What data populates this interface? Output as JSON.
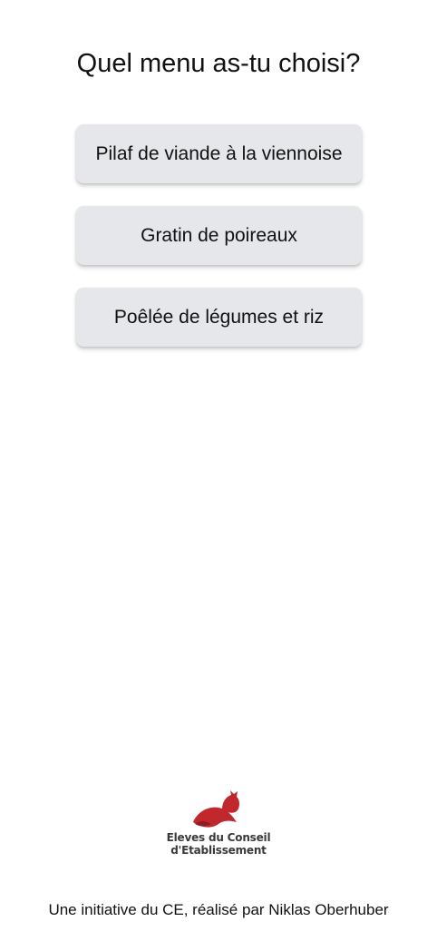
{
  "question": "Quel menu as-tu choisi?",
  "menus": [
    {
      "label": "Pilaf de viande à la viennoise"
    },
    {
      "label": "Gratin de poireaux"
    },
    {
      "label": "Poêlée de légumes et riz"
    }
  ],
  "logo": {
    "line1": "Eleves du Conseil",
    "line2": "d'Etablissement",
    "icon": "fox-icon",
    "color": "#c0282d"
  },
  "footer": "Une initiative du CE, réalisé par Niklas Oberhuber"
}
